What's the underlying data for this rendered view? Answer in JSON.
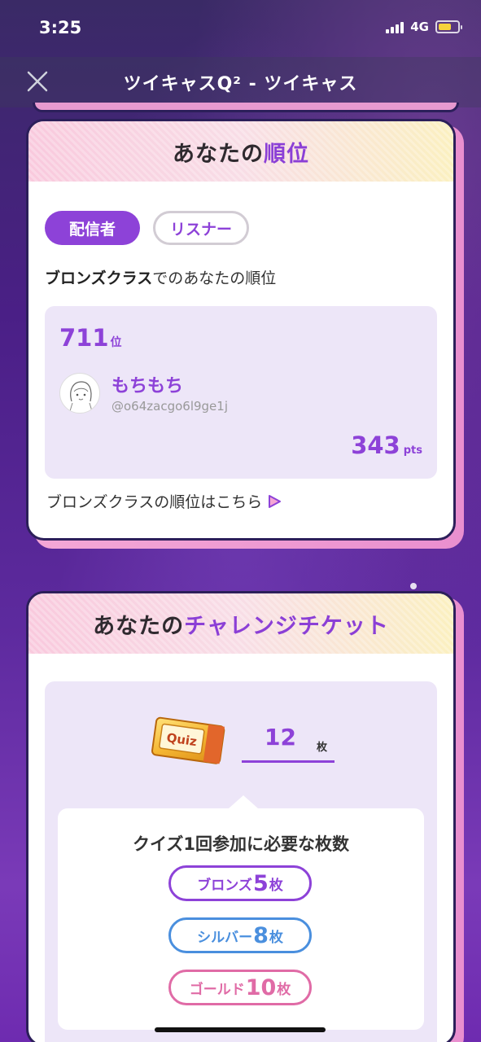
{
  "status_bar": {
    "time": "3:25",
    "network": "4G",
    "battery_level": 0.7
  },
  "nav": {
    "title": "ツイキャスQ² - ツイキャス"
  },
  "ranking": {
    "header_prefix": "あなたの",
    "header_accent": "順位",
    "tabs": [
      "配信者",
      "リスナー"
    ],
    "active_tab": "配信者",
    "caption_bold": "ブロンズクラス",
    "caption_rest": "でのあなたの順位",
    "rank_number": "711",
    "rank_unit": "位",
    "user_name": "もちもち",
    "user_handle": "@o64zacgo6l9ge1j",
    "points": "343",
    "points_unit": "pts",
    "link_text": "ブロンズクラスの順位はこちら"
  },
  "ticket": {
    "header_prefix": "あなたの",
    "header_accent": "チャレンジチケット",
    "ticket_label": "Quiz",
    "count": "12",
    "count_unit": "枚",
    "requirement_title": "クイズ1回参加に必要な枚数",
    "tiers": [
      {
        "label": "ブロンズ",
        "count": "5",
        "unit": "枚"
      },
      {
        "label": "シルバー",
        "count": "8",
        "unit": "枚"
      },
      {
        "label": "ゴールド",
        "count": "10",
        "unit": "枚"
      }
    ]
  },
  "colors": {
    "accent_purple": "#8d42d8",
    "silver_blue": "#4a8fde",
    "gold_pink": "#e06ba6",
    "battery": "#f5d23b"
  }
}
